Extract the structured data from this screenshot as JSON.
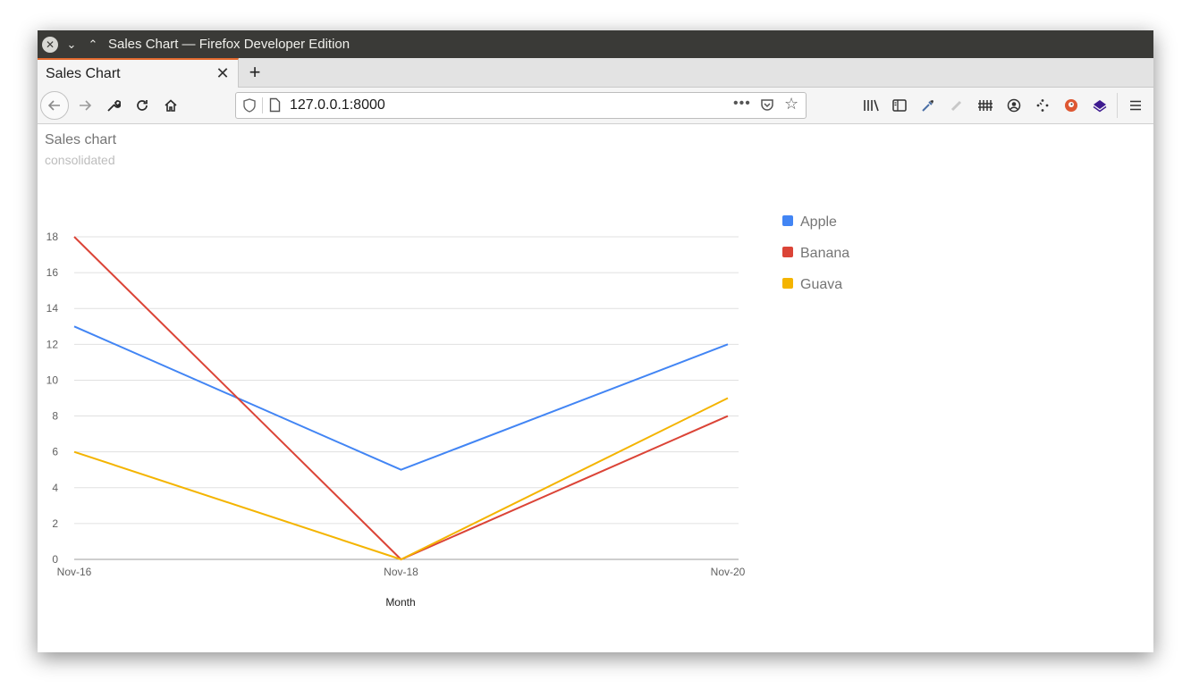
{
  "window": {
    "title": "Sales Chart — Firefox Developer Edition"
  },
  "tabs": [
    {
      "label": "Sales Chart",
      "active": true
    }
  ],
  "navbar": {
    "url": "127.0.0.1:8000",
    "more_glyph": "•••"
  },
  "page": {
    "title": "Sales chart",
    "subtitle": "consolidated"
  },
  "colors": {
    "Apple": "#4285f4",
    "Banana": "#db4437",
    "Guava": "#f4b400",
    "accent_tab": "#e36a2f"
  },
  "chart_data": {
    "type": "line",
    "title": "Sales chart",
    "subtitle": "consolidated",
    "x": [
      "Nov-16",
      "Nov-18",
      "Nov-20"
    ],
    "xlabel": "Month",
    "ylabel": "",
    "ylim": [
      0,
      18
    ],
    "yticks": [
      0,
      2,
      4,
      6,
      8,
      10,
      12,
      14,
      16,
      18
    ],
    "grid": true,
    "legend_position": "right",
    "series": [
      {
        "name": "Apple",
        "values": [
          13,
          5,
          12
        ]
      },
      {
        "name": "Banana",
        "values": [
          18,
          0,
          8
        ]
      },
      {
        "name": "Guava",
        "values": [
          6,
          0,
          9
        ]
      }
    ]
  }
}
